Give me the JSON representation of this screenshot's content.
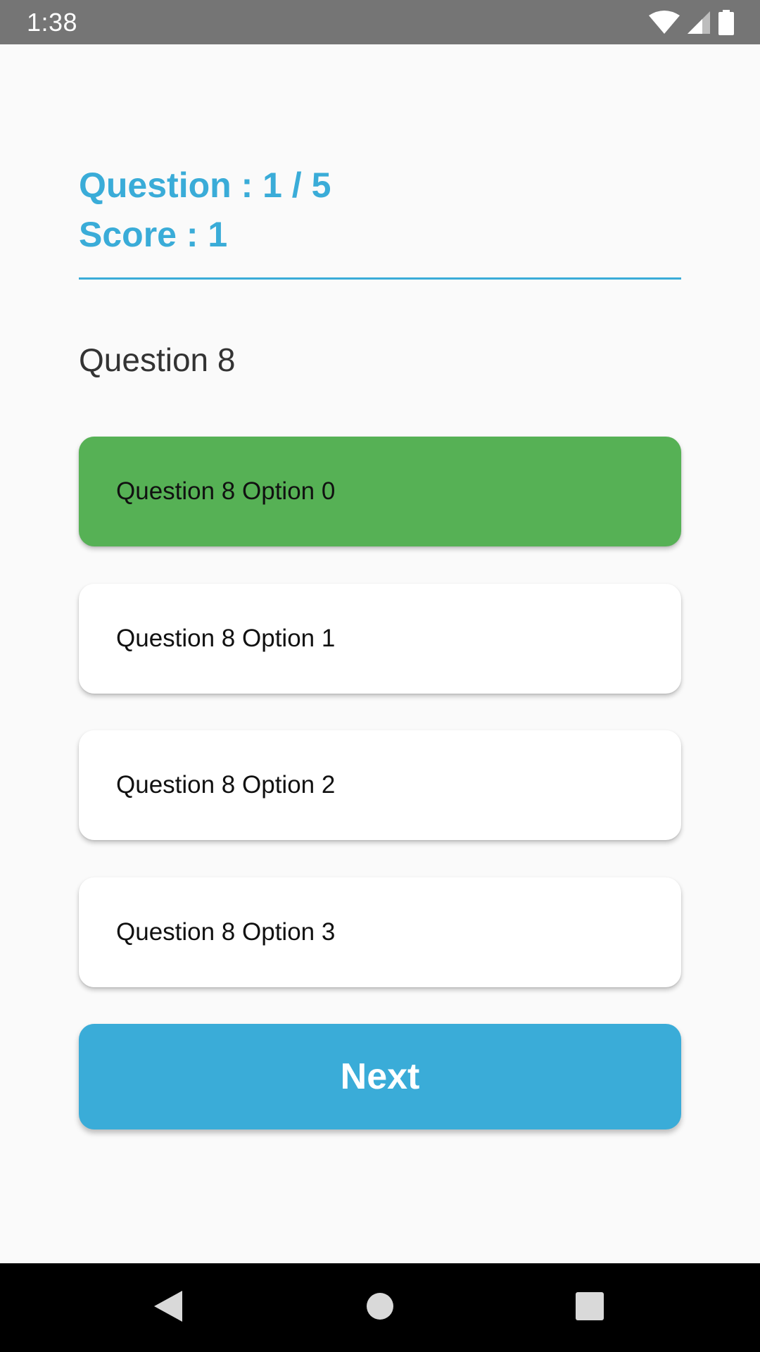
{
  "status_bar": {
    "time": "1:38",
    "icons": [
      "wifi-icon",
      "signal-icon",
      "battery-icon"
    ]
  },
  "quiz": {
    "progress_label": "Question : 1 / 5",
    "score_label": "Score : 1",
    "question": "Question 8",
    "options": [
      {
        "label": "Question 8 Option 0",
        "state": "correct"
      },
      {
        "label": "Question 8 Option 1",
        "state": "default"
      },
      {
        "label": "Question 8 Option 2",
        "state": "default"
      },
      {
        "label": "Question 8 Option 3",
        "state": "default"
      }
    ],
    "next_label": "Next"
  },
  "nav_bar": {
    "buttons": [
      "back-icon",
      "home-icon",
      "recents-icon"
    ]
  },
  "colors": {
    "accent": "#3aacd8",
    "correct": "#56b155",
    "status_bar": "#757575",
    "background": "#fafafa"
  }
}
